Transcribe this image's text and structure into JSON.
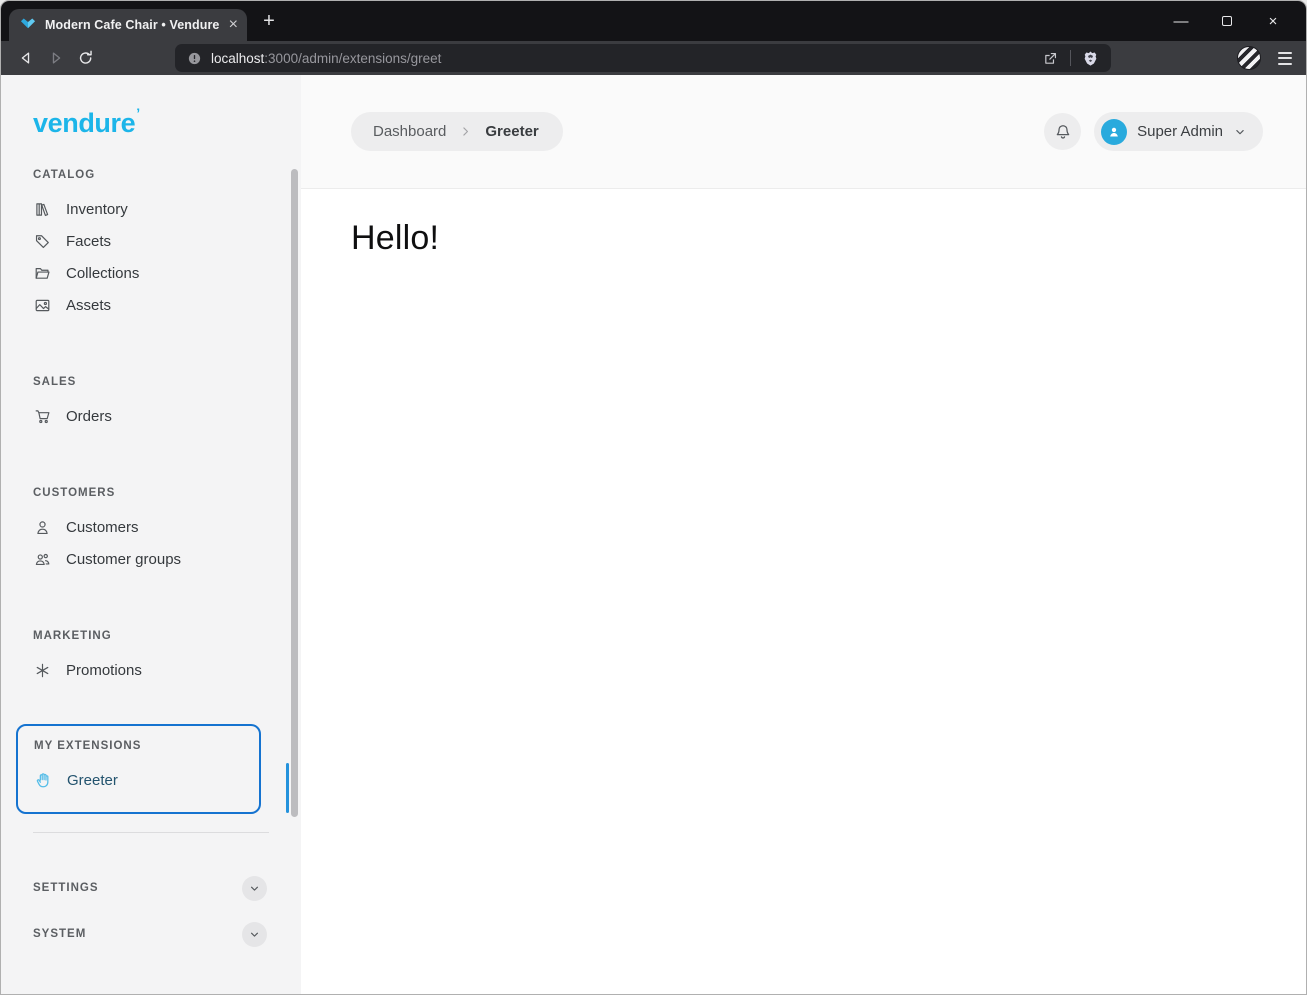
{
  "browser": {
    "tab_title": "Modern Cafe Chair • Vendure",
    "tab_close": "×",
    "new_tab": "+",
    "window_controls": {
      "minimize": "—",
      "close": "×"
    },
    "url": {
      "host": "localhost",
      "path": ":3000/admin/extensions/greet"
    }
  },
  "sidebar": {
    "logo": "vendure",
    "logo_mark": "’",
    "sections": [
      {
        "title": "CATALOG",
        "items": [
          {
            "label": "Inventory",
            "icon": "inventory-icon"
          },
          {
            "label": "Facets",
            "icon": "tag-icon"
          },
          {
            "label": "Collections",
            "icon": "folder-icon"
          },
          {
            "label": "Assets",
            "icon": "image-icon"
          }
        ]
      },
      {
        "title": "SALES",
        "items": [
          {
            "label": "Orders",
            "icon": "cart-icon"
          }
        ]
      },
      {
        "title": "CUSTOMERS",
        "items": [
          {
            "label": "Customers",
            "icon": "user-icon"
          },
          {
            "label": "Customer groups",
            "icon": "users-icon"
          }
        ]
      },
      {
        "title": "MARKETING",
        "items": [
          {
            "label": "Promotions",
            "icon": "asterisk-icon"
          }
        ]
      }
    ],
    "extensions": {
      "title": "MY EXTENSIONS",
      "item": {
        "label": "Greeter",
        "icon": "waving-hand-icon",
        "active": true
      }
    },
    "collapsed_sections": [
      {
        "title": "SETTINGS"
      },
      {
        "title": "SYSTEM"
      }
    ]
  },
  "header": {
    "breadcrumb": {
      "home": "Dashboard",
      "current": "Greeter"
    },
    "user_name": "Super Admin"
  },
  "main": {
    "greeting": "Hello!"
  },
  "colors": {
    "brand": "#1cb5e9",
    "highlight_border": "#1573d0",
    "avatar": "#29aadd",
    "hand": "#56bde8"
  }
}
